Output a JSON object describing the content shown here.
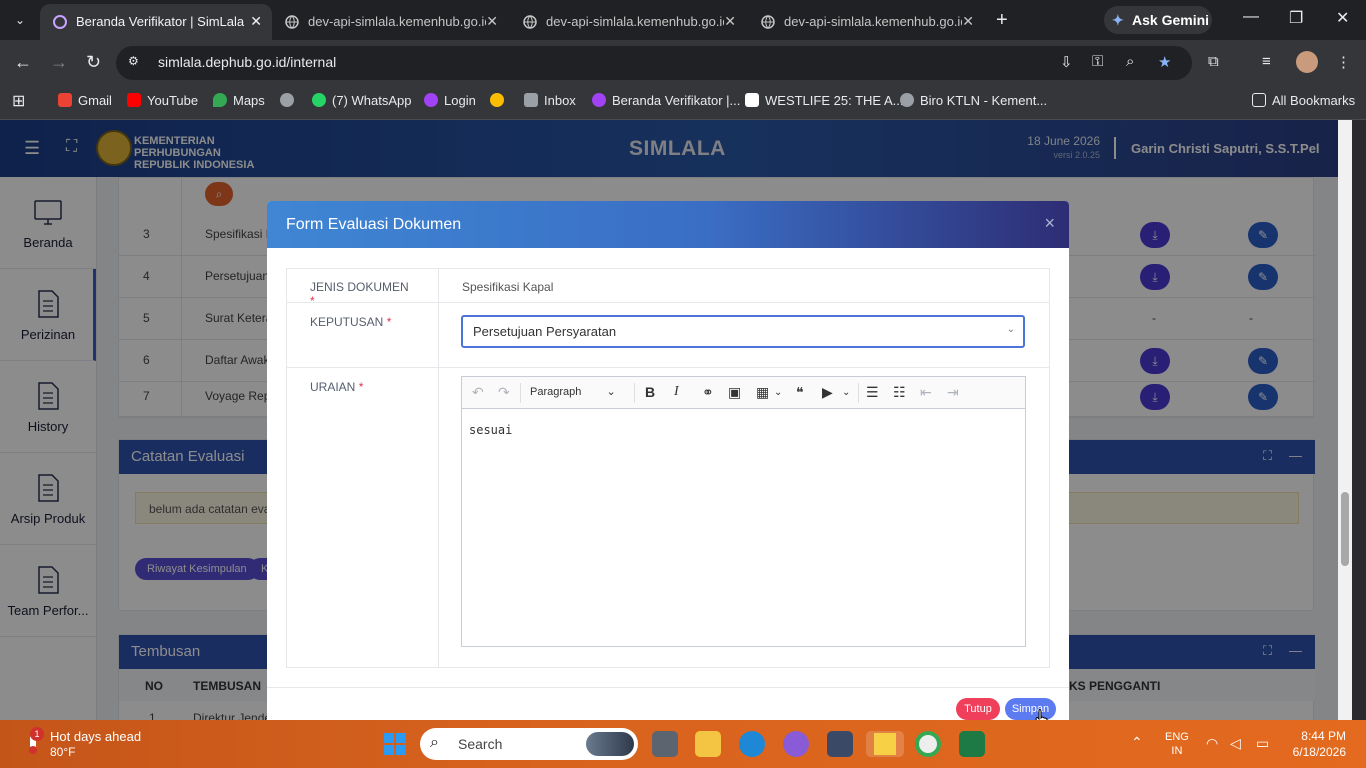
{
  "browser": {
    "tabs": [
      {
        "title": "Beranda Verifikator | SimLala",
        "active": true
      },
      {
        "title": "dev-api-simlala.kemenhub.go.id",
        "active": false
      },
      {
        "title": "dev-api-simlala.kemenhub.go.id",
        "active": false
      },
      {
        "title": "dev-api-simlala.kemenhub.go.id",
        "active": false
      }
    ],
    "new_tab": "+",
    "ask_gemini": "Ask Gemini",
    "url": "simlala.dephub.go.id/internal",
    "bookmarks": [
      {
        "label": "Gmail",
        "color": "#ea4335"
      },
      {
        "label": "YouTube",
        "color": "#ff0000"
      },
      {
        "label": "Maps",
        "color": "#34a853"
      },
      {
        "label": "",
        "color": "#9aa0a6"
      },
      {
        "label": "(7) WhatsApp",
        "color": "#25d366"
      },
      {
        "label": "Login",
        "color": "#a142f4"
      },
      {
        "label": "",
        "color": "#fbbc04"
      },
      {
        "label": "Inbox",
        "color": "#9aa0a6"
      },
      {
        "label": "Beranda Verifikator |...",
        "color": "#a142f4"
      },
      {
        "label": "WESTLIFE 25: THE A...",
        "color": "#ffffff"
      },
      {
        "label": "Biro KTLN - Kement...",
        "color": "#9aa0a6"
      }
    ],
    "all_bookmarks": "All Bookmarks"
  },
  "app": {
    "org_line1": "KEMENTERIAN PERHUBUNGAN",
    "org_line2": "REPUBLIK INDONESIA",
    "brand": "SIMLALA",
    "date": "18 June 2026",
    "version": "versi 2.0.25",
    "user": "Garin Christi Saputri, S.S.T.Pel",
    "sidebar": [
      {
        "label": "Beranda",
        "icon": "monitor-icon"
      },
      {
        "label": "Perizinan",
        "icon": "document-icon"
      },
      {
        "label": "History",
        "icon": "document-icon"
      },
      {
        "label": "Arsip Produk",
        "icon": "document-icon"
      },
      {
        "label": "Team Perfor...",
        "icon": "document-icon"
      }
    ],
    "doc_rows": [
      {
        "no": "3",
        "name": "Spesifikasi Ka",
        "has_buttons": true
      },
      {
        "no": "4",
        "name": "Persetujuan S",
        "has_buttons": true
      },
      {
        "no": "5",
        "name": "Surat Keterar",
        "has_buttons": false
      },
      {
        "no": "6",
        "name": "Daftar Awak",
        "has_buttons": true
      },
      {
        "no": "7",
        "name": "Voyage Repc",
        "has_buttons": true
      }
    ],
    "dash": "-",
    "catatan_title": "Catatan Evaluasi",
    "catatan_empty": "belum ada catatan evalu",
    "riwayat_label": "Riwayat Kesimpulan",
    "second_pill": "K",
    "tembusan_title": "Tembusan",
    "tembusan_cols": [
      "NO",
      "TEMBUSAN",
      "KS PENGGANTI"
    ],
    "tembusan_first_no": "1",
    "tembusan_first_name": "Direktur Jender"
  },
  "modal": {
    "title": "Form Evaluasi Dokumen",
    "close": "×",
    "fields": {
      "jenis_label": "JENIS DOKUMEN",
      "jenis_value": "Spesifikasi Kapal",
      "keputusan_label": "KEPUTUSAN",
      "keputusan_value": "Persetujuan Persyaratan",
      "uraian_label": "URAIAN",
      "required_mark": "*"
    },
    "editor": {
      "heading_value": "Paragraph",
      "content": "sesuai"
    },
    "buttons": {
      "tutup": "Tutup",
      "simpan": "Simpan"
    }
  },
  "taskbar": {
    "weather_title": "Hot days ahead",
    "weather_temp": "80°F",
    "weather_badge": "1",
    "search_placeholder": "Search",
    "lang_line1": "ENG",
    "lang_line2": "IN",
    "time": "8:44 PM",
    "date": "6/18/2026"
  }
}
